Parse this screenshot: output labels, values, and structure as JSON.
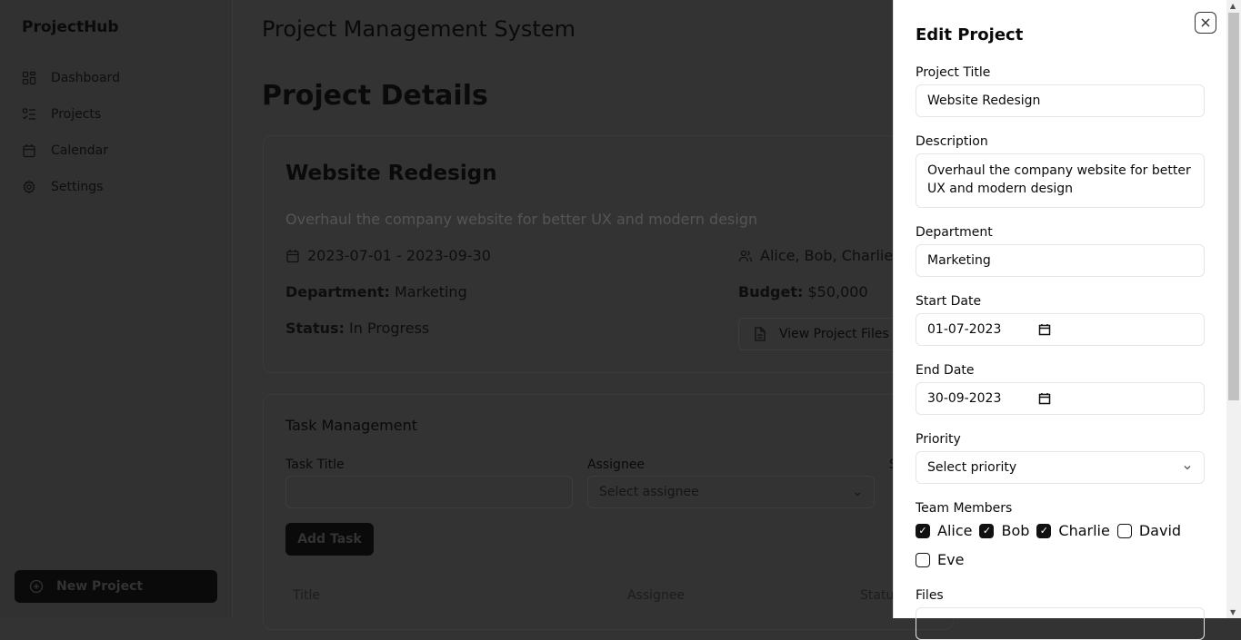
{
  "sidebar": {
    "brand": "ProjectHub",
    "items": [
      {
        "label": "Dashboard",
        "icon": "dashboard-icon"
      },
      {
        "label": "Projects",
        "icon": "list-check-icon"
      },
      {
        "label": "Calendar",
        "icon": "calendar-icon"
      },
      {
        "label": "Settings",
        "icon": "gear-icon"
      }
    ],
    "new_project": "New Project"
  },
  "main": {
    "app_title": "Project Management System",
    "page_title": "Project Details",
    "project": {
      "title": "Website Redesign",
      "description": "Overhaul the company website for better UX and modern design",
      "dates": "2023-07-01 - 2023-09-30",
      "team": "Alice, Bob, Charlie",
      "department_label": "Department:",
      "department": "Marketing",
      "budget_label": "Budget:",
      "budget": "$50,000",
      "status_label": "Status:",
      "status": "In Progress",
      "view_files": "View Project Files"
    },
    "tasks": {
      "heading": "Task Management",
      "task_title_label": "Task Title",
      "assignee_label": "Assignee",
      "assignee_placeholder": "Select assignee",
      "third_label": "S",
      "add_task": "Add Task",
      "columns": [
        "Title",
        "Assignee",
        "Statu"
      ]
    }
  },
  "panel": {
    "title": "Edit Project",
    "project_title_label": "Project Title",
    "project_title": "Website Redesign",
    "description_label": "Description",
    "description": "Overhaul the company website for better UX and modern design",
    "department_label": "Department",
    "department": "Marketing",
    "start_label": "Start Date",
    "start": "01-07-2023",
    "end_label": "End Date",
    "end": "30-09-2023",
    "priority_label": "Priority",
    "priority_placeholder": "Select priority",
    "team_label": "Team Members",
    "members": [
      {
        "name": "Alice",
        "checked": true
      },
      {
        "name": "Bob",
        "checked": true
      },
      {
        "name": "Charlie",
        "checked": true
      },
      {
        "name": "David",
        "checked": false
      },
      {
        "name": "Eve",
        "checked": false
      }
    ],
    "files_label": "Files"
  }
}
